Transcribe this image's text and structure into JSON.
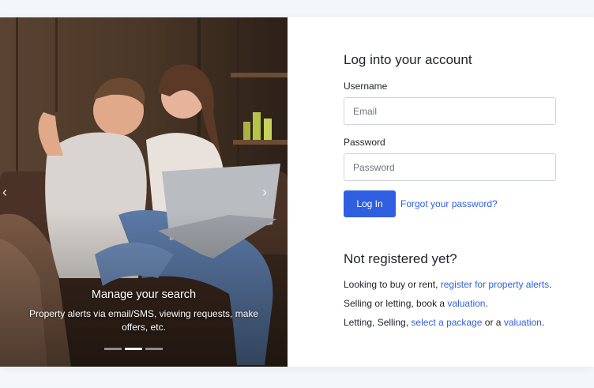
{
  "carousel": {
    "prev_icon": "chevron-left-icon",
    "next_icon": "chevron-right-icon",
    "prev_glyph": "‹",
    "next_glyph": "›",
    "slide_title": "Manage your search",
    "slide_text": "Property alerts via email/SMS, viewing requests, make offers, etc.",
    "slide_count": 3,
    "active_slide": 2
  },
  "login": {
    "title": "Log into your account",
    "username_label": "Username",
    "username_placeholder": "Email",
    "password_label": "Password",
    "password_placeholder": "Password",
    "login_button": "Log In",
    "forgot_link": "Forgot your password?"
  },
  "register": {
    "title": "Not registered yet?",
    "line1_text": "Looking to buy or rent, ",
    "line1_link": "register for property alerts",
    "line1_end": ".",
    "line2_text": "Selling or letting, book a ",
    "line2_link": "valuation",
    "line2_end": ".",
    "line3_text": "Letting, Selling, ",
    "line3_link1": "select a package",
    "line3_mid": " or a ",
    "line3_link2": "valuation",
    "line3_end": "."
  },
  "colors": {
    "accent": "#2f5fe0",
    "page_bg": "#f3f6fa"
  }
}
